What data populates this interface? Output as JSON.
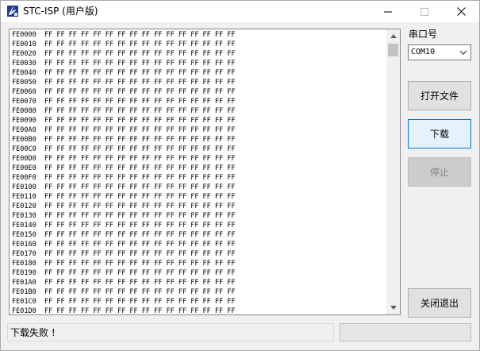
{
  "window": {
    "title": "STC-ISP (用户版)"
  },
  "hex_view": {
    "lines": [
      {
        "address": "FE0000",
        "bytes": "FF FF FF FF FF FF FF FF FF FF FF FF FF FF FF FF"
      },
      {
        "address": "FE0010",
        "bytes": "FF FF FF FF FF FF FF FF FF FF FF FF FF FF FF FF"
      },
      {
        "address": "FE0020",
        "bytes": "FF FF FF FF FF FF FF FF FF FF FF FF FF FF FF FF"
      },
      {
        "address": "FE0030",
        "bytes": "FF FF FF FF FF FF FF FF FF FF FF FF FF FF FF FF"
      },
      {
        "address": "FE0040",
        "bytes": "FF FF FF FF FF FF FF FF FF FF FF FF FF FF FF FF"
      },
      {
        "address": "FE0050",
        "bytes": "FF FF FF FF FF FF FF FF FF FF FF FF FF FF FF FF"
      },
      {
        "address": "FE0060",
        "bytes": "FF FF FF FF FF FF FF FF FF FF FF FF FF FF FF FF"
      },
      {
        "address": "FE0070",
        "bytes": "FF FF FF FF FF FF FF FF FF FF FF FF FF FF FF FF"
      },
      {
        "address": "FE0080",
        "bytes": "FF FF FF FF FF FF FF FF FF FF FF FF FF FF FF FF"
      },
      {
        "address": "FE0090",
        "bytes": "FF FF FF FF FF FF FF FF FF FF FF FF FF FF FF FF"
      },
      {
        "address": "FE00A0",
        "bytes": "FF FF FF FF FF FF FF FF FF FF FF FF FF FF FF FF"
      },
      {
        "address": "FE00B0",
        "bytes": "FF FF FF FF FF FF FF FF FF FF FF FF FF FF FF FF"
      },
      {
        "address": "FE00C0",
        "bytes": "FF FF FF FF FF FF FF FF FF FF FF FF FF FF FF FF"
      },
      {
        "address": "FE00D0",
        "bytes": "FF FF FF FF FF FF FF FF FF FF FF FF FF FF FF FF"
      },
      {
        "address": "FE00E0",
        "bytes": "FF FF FF FF FF FF FF FF FF FF FF FF FF FF FF FF"
      },
      {
        "address": "FE00F0",
        "bytes": "FF FF FF FF FF FF FF FF FF FF FF FF FF FF FF FF"
      },
      {
        "address": "FE0100",
        "bytes": "FF FF FF FF FF FF FF FF FF FF FF FF FF FF FF FF"
      },
      {
        "address": "FE0110",
        "bytes": "FF FF FF FF FF FF FF FF FF FF FF FF FF FF FF FF"
      },
      {
        "address": "FE0120",
        "bytes": "FF FF FF FF FF FF FF FF FF FF FF FF FF FF FF FF"
      },
      {
        "address": "FE0130",
        "bytes": "FF FF FF FF FF FF FF FF FF FF FF FF FF FF FF FF"
      },
      {
        "address": "FE0140",
        "bytes": "FF FF FF FF FF FF FF FF FF FF FF FF FF FF FF FF"
      },
      {
        "address": "FE0150",
        "bytes": "FF FF FF FF FF FF FF FF FF FF FF FF FF FF FF FF"
      },
      {
        "address": "FE0160",
        "bytes": "FF FF FF FF FF FF FF FF FF FF FF FF FF FF FF FF"
      },
      {
        "address": "FE0170",
        "bytes": "FF FF FF FF FF FF FF FF FF FF FF FF FF FF FF FF"
      },
      {
        "address": "FE0180",
        "bytes": "FF FF FF FF FF FF FF FF FF FF FF FF FF FF FF FF"
      },
      {
        "address": "FE0190",
        "bytes": "FF FF FF FF FF FF FF FF FF FF FF FF FF FF FF FF"
      },
      {
        "address": "FE01A0",
        "bytes": "FF FF FF FF FF FF FF FF FF FF FF FF FF FF FF FF"
      },
      {
        "address": "FE01B0",
        "bytes": "FF FF FF FF FF FF FF FF FF FF FF FF FF FF FF FF"
      },
      {
        "address": "FE01C0",
        "bytes": "FF FF FF FF FF FF FF FF FF FF FF FF FF FF FF FF"
      },
      {
        "address": "FE01D0",
        "bytes": "FF FF FF FF FF FF FF FF FF FF FF FF FF FF FF FF"
      }
    ]
  },
  "sidebar": {
    "port_label": "串口号",
    "port_value": "COM10",
    "open_file_label": "打开文件",
    "download_label": "下载",
    "stop_label": "停止",
    "exit_label": "关闭退出"
  },
  "status": {
    "message": "下载失败 !",
    "progress": 0
  },
  "icons": {
    "app": "stc-isp-app-icon",
    "minimize": "minimize-icon",
    "maximize": "maximize-icon",
    "close": "close-icon",
    "scroll_up": "scroll-up-arrow-icon",
    "scroll_down": "scroll-down-arrow-icon",
    "dropdown": "chevron-down-icon"
  },
  "colors": {
    "download_accent": "#0078d7",
    "progress_fill": "#06b025"
  }
}
